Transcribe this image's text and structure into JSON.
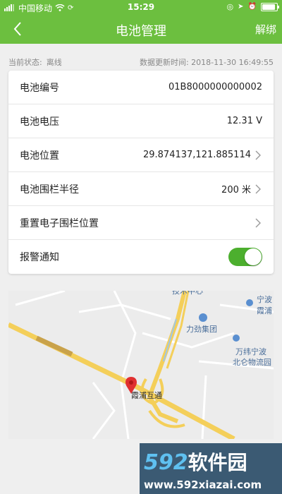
{
  "status_bar": {
    "carrier": "中国移动",
    "time": "15:29",
    "wifi_icon": "wifi-icon",
    "battery_icon": "battery-icon"
  },
  "nav": {
    "back_icon": "chevron-left-icon",
    "title": "电池管理",
    "action": "解绑"
  },
  "meta": {
    "status_label": "当前状态:",
    "status_value": "离线",
    "updated_label": "数据更新时间:",
    "updated_value": "2018-11-30 16:49:55"
  },
  "rows": [
    {
      "label": "电池编号",
      "value": "01B8000000000002",
      "chevron": false
    },
    {
      "label": "电池电压",
      "value": "12.31 V",
      "chevron": false
    },
    {
      "label": "电池位置",
      "value": "29.874137,121.885114",
      "chevron": true
    },
    {
      "label": "电池围栏半径",
      "value": "200 米",
      "chevron": true
    },
    {
      "label": "重置电子围栏位置",
      "value": "",
      "chevron": true
    },
    {
      "label": "报警通知",
      "toggle_on": true
    }
  ],
  "map": {
    "pois": [
      "宁波",
      "霞浦",
      "力劲集团",
      "万纬宁波",
      "北仑物流园",
      "霞浦互通",
      "技术中心"
    ],
    "marker_icon": "map-pin-icon",
    "road_color": "#f4cf5a"
  },
  "watermark": {
    "logo_digits": "592",
    "logo_text": "软件园",
    "url": "www.592xiazai.com"
  },
  "colors": {
    "accent": "#6cbf3f",
    "toggle_on": "#4caf2e"
  }
}
